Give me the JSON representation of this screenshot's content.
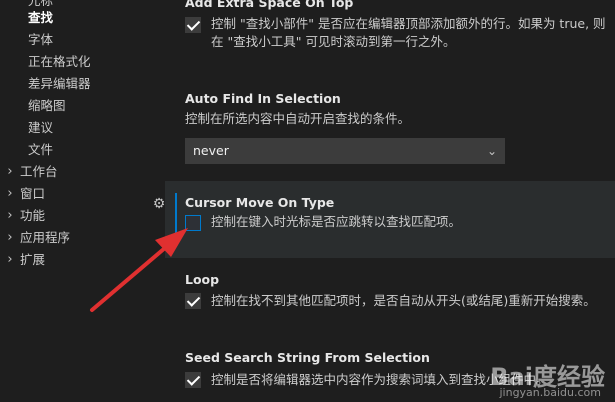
{
  "sidebar": {
    "items": [
      {
        "label": "光标",
        "expanded": null
      },
      {
        "label": "查找",
        "expanded": null
      },
      {
        "label": "字体",
        "expanded": null
      },
      {
        "label": "正在格式化",
        "expanded": null
      },
      {
        "label": "差异编辑器",
        "expanded": null
      },
      {
        "label": "缩略图",
        "expanded": null
      },
      {
        "label": "建议",
        "expanded": null
      },
      {
        "label": "文件",
        "expanded": null
      },
      {
        "label": "工作台",
        "expanded": false
      },
      {
        "label": "窗口",
        "expanded": false
      },
      {
        "label": "功能",
        "expanded": false
      },
      {
        "label": "应用程序",
        "expanded": false
      },
      {
        "label": "扩展",
        "expanded": false
      }
    ],
    "active_index": 1
  },
  "settings": {
    "add_extra_space": {
      "title": "Add Extra Space On Top",
      "checked": true,
      "desc_line1": "控制 \"查找小部件\" 是否应在编辑器顶部添加额外的行。如果为 true, 则",
      "desc_line2": "在 \"查找小工具\" 可见时滚动到第一行之外。"
    },
    "auto_find_in_selection": {
      "title": "Auto Find In Selection",
      "desc": "控制在所选内容中自动开启查找的条件。",
      "value": "never"
    },
    "cursor_move_on_type": {
      "title": "Cursor Move On Type",
      "checked": false,
      "desc": "控制在键入时光标是否应跳转以查找匹配项。"
    },
    "loop": {
      "title": "Loop",
      "checked": true,
      "desc": "控制在找不到其他匹配项时，是否自动从开头(或结尾)重新开始搜索。"
    },
    "seed_search": {
      "title": "Seed Search String From Selection",
      "checked": true,
      "desc": "控制是否将编辑器选中内容作为搜索词填入到查找小组件中。"
    }
  },
  "icons": {
    "gear": "gear-icon",
    "chevron_right": "chevron-right-icon",
    "chevron_down": "chevron-down-icon",
    "check": "check-icon"
  },
  "colors": {
    "background": "#1e1e1e",
    "focus": "#007acc",
    "arrow": "#e03030"
  },
  "watermark": {
    "text": "Bai度经验",
    "sub": "jingyan.baidu.com"
  }
}
